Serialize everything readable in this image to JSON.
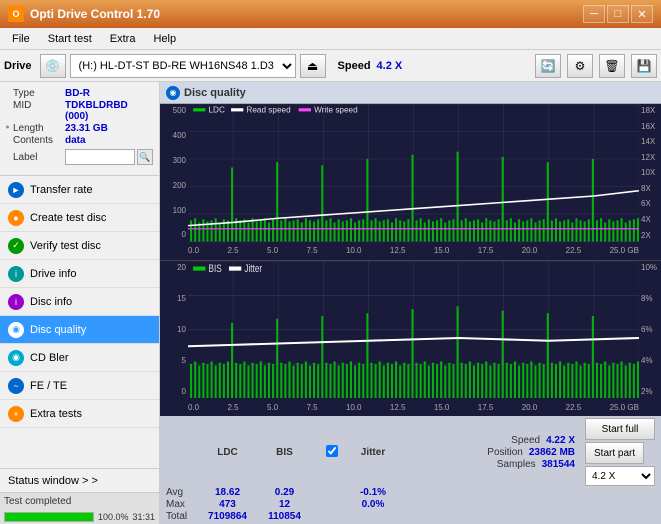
{
  "titleBar": {
    "title": "Opti Drive Control 1.70",
    "minimize": "─",
    "maximize": "□",
    "close": "✕"
  },
  "menuBar": {
    "items": [
      "File",
      "Start test",
      "Extra",
      "Help"
    ]
  },
  "driveBar": {
    "label": "Drive",
    "driveValue": "(H:)  HL-DT-ST BD-RE  WH16NS48 1.D3",
    "speedLabel": "Speed",
    "speedValue": "4.2 X"
  },
  "disc": {
    "type_label": "Type",
    "type_val": "BD-R",
    "mid_label": "MID",
    "mid_val": "TDKBLDRBD (000)",
    "length_label": "Length",
    "length_val": "23.31 GB",
    "contents_label": "Contents",
    "contents_val": "data",
    "label_label": "Label",
    "label_val": ""
  },
  "nav": {
    "items": [
      {
        "id": "transfer-rate",
        "label": "Transfer rate",
        "icon": "►",
        "iconColor": "blue"
      },
      {
        "id": "create-test-disc",
        "label": "Create test disc",
        "icon": "●",
        "iconColor": "orange"
      },
      {
        "id": "verify-test-disc",
        "label": "Verify test disc",
        "icon": "✓",
        "iconColor": "green"
      },
      {
        "id": "drive-info",
        "label": "Drive info",
        "icon": "i",
        "iconColor": "teal"
      },
      {
        "id": "disc-info",
        "label": "Disc info",
        "icon": "i",
        "iconColor": "purple"
      },
      {
        "id": "disc-quality",
        "label": "Disc quality",
        "icon": "◉",
        "iconColor": "white-active",
        "active": true
      },
      {
        "id": "cd-bler",
        "label": "CD Bler",
        "icon": "◉",
        "iconColor": "cyan"
      },
      {
        "id": "fe-te",
        "label": "FE / TE",
        "icon": "~",
        "iconColor": "blue"
      },
      {
        "id": "extra-tests",
        "label": "Extra tests",
        "icon": "+",
        "iconColor": "orange"
      }
    ]
  },
  "statusWindow": {
    "label": "Status window > >"
  },
  "progressBar": {
    "fill": 100,
    "label": "100.0%"
  },
  "statusText": "Test completed",
  "discQuality": {
    "title": "Disc quality",
    "chart1": {
      "legend": [
        {
          "label": "LDC",
          "color": "#00cc00"
        },
        {
          "label": "Read speed",
          "color": "#ffffff"
        },
        {
          "label": "Write speed",
          "color": "#ff00ff"
        }
      ],
      "yLabels": [
        "500",
        "400",
        "300",
        "200",
        "100",
        "0"
      ],
      "yLabelsRight": [
        "18X",
        "16X",
        "14X",
        "12X",
        "10X",
        "8X",
        "6X",
        "4X",
        "2X"
      ],
      "xLabels": [
        "0.0",
        "2.5",
        "5.0",
        "7.5",
        "10.0",
        "12.5",
        "15.0",
        "17.5",
        "20.0",
        "22.5",
        "25.0 GB"
      ]
    },
    "chart2": {
      "legend": [
        {
          "label": "BIS",
          "color": "#00cc00"
        },
        {
          "label": "Jitter",
          "color": "#ffffff"
        }
      ],
      "yLabels": [
        "20",
        "15",
        "10",
        "5",
        "0"
      ],
      "yLabelsRight": [
        "10%",
        "8%",
        "6%",
        "4%",
        "2%"
      ],
      "xLabels": [
        "0.0",
        "2.5",
        "5.0",
        "7.5",
        "10.0",
        "12.5",
        "15.0",
        "17.5",
        "20.0",
        "22.5",
        "25.0 GB"
      ]
    }
  },
  "stats": {
    "headers": [
      "LDC",
      "BIS",
      "",
      "Jitter",
      "Speed",
      ""
    ],
    "avg": {
      "ldc": "18.62",
      "bis": "0.29",
      "jitter": "-0.1%"
    },
    "max": {
      "ldc": "473",
      "bis": "12",
      "jitter": "0.0%"
    },
    "total": {
      "ldc": "7109864",
      "bis": "110854"
    },
    "speed": {
      "val": "4.22 X",
      "label": "Speed"
    },
    "position": {
      "val": "23862 MB",
      "label": "Position"
    },
    "samples": {
      "val": "381544",
      "label": "Samples"
    },
    "startFull": "Start full",
    "startPart": "Start part",
    "speedDropdown": "4.2 X",
    "jitterChecked": true,
    "jitterLabel": "Jitter",
    "rowLabels": [
      "Avg",
      "Max",
      "Total"
    ]
  }
}
